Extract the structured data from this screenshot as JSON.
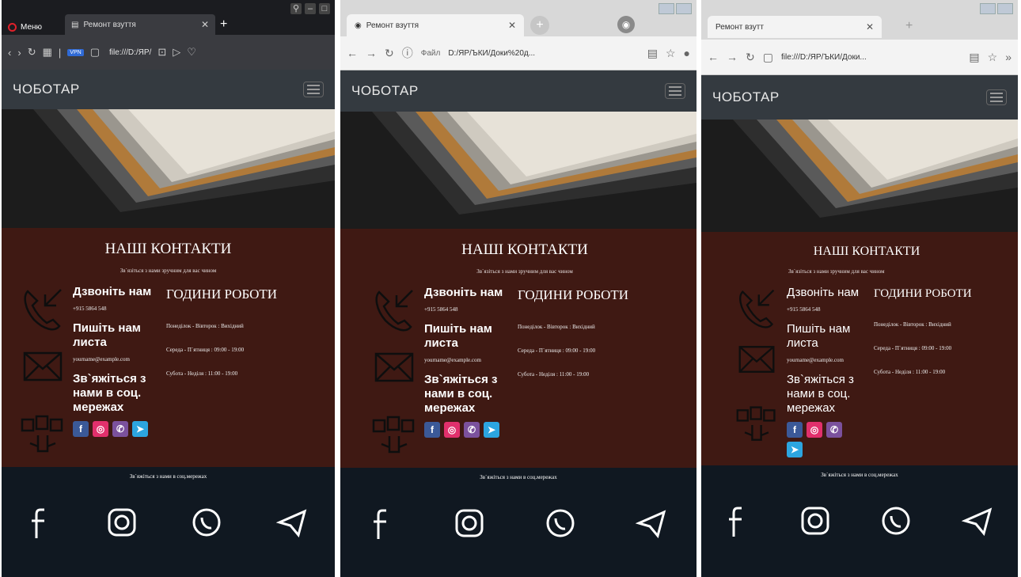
{
  "opera": {
    "menu_label": "Меню",
    "tab_title": "Ремонт взуття",
    "url": "file:///D:/ЯР/",
    "vpn_label": "VPN"
  },
  "chrome_a": {
    "tab_title": "Ремонт взуття",
    "url_prefix": "Файл",
    "url": "D:/ЯР/ЪКИ/Доки%20д..."
  },
  "chrome_b": {
    "tab_title": "Ремонт взутт",
    "url": "file:///D:/ЯР/ЪКИ/Доки..."
  },
  "site": {
    "brand": "ЧОБОТАР",
    "contacts_title": "НАШІ КОНТАКТИ",
    "contacts_sub": "Зв`язіться з нами зручним для вас чином",
    "call_heading": "Дзвоніть нам",
    "phone": "+915 5864 548",
    "mail_heading": "Пишіть нам листа",
    "email": "yourname@example.com",
    "social_heading": "Зв`яжіться з нами в соц. мережах",
    "hours_title": "ГОДИНИ РОБОТИ",
    "hours": [
      "Понеділок - Вівторок : Вихідний",
      "Середа - П`ятниця : 09:00 - 19:00",
      "Субота - Неділя : 11:00 - 19:00"
    ],
    "footer_text": "Зв`яжіться з нами в соц.мережах"
  },
  "colors": {
    "contacts_bg": "#3f1913",
    "footer_bg": "#101821",
    "nav_bg": "#343a40"
  }
}
